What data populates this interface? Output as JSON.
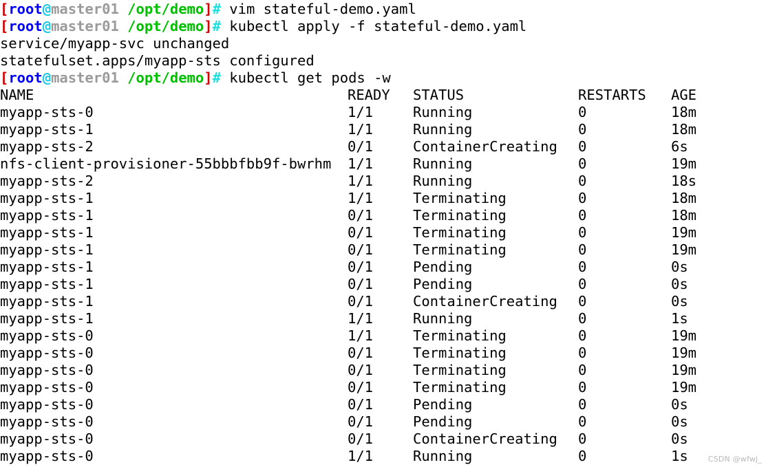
{
  "terminal": {
    "prompt": {
      "open_bracket": "[",
      "user": "root",
      "at": "@",
      "host": "master01",
      "path": "/opt/demo",
      "close_bracket": "]",
      "hash": "#"
    },
    "commands": {
      "cmd1": " vim stateful-demo.yaml",
      "cmd2": " kubectl apply -f stateful-demo.yaml",
      "cmd3": " kubectl get pods -w"
    },
    "apply_output": {
      "line1": "service/myapp-svc unchanged",
      "line2": "statefulset.apps/myapp-sts configured"
    },
    "table": {
      "headers": {
        "name": "NAME",
        "ready": "READY",
        "status": "STATUS",
        "restarts": "RESTARTS",
        "age": "AGE"
      },
      "rows": [
        {
          "name": "myapp-sts-0",
          "ready": "1/1",
          "status": "Running",
          "restarts": "0",
          "age": "18m"
        },
        {
          "name": "myapp-sts-1",
          "ready": "1/1",
          "status": "Running",
          "restarts": "0",
          "age": "18m"
        },
        {
          "name": "myapp-sts-2",
          "ready": "0/1",
          "status": "ContainerCreating",
          "restarts": "0",
          "age": "6s"
        },
        {
          "name": "nfs-client-provisioner-55bbbfbb9f-bwrhm",
          "ready": "1/1",
          "status": "Running",
          "restarts": "0",
          "age": "19m"
        },
        {
          "name": "myapp-sts-2",
          "ready": "1/1",
          "status": "Running",
          "restarts": "0",
          "age": "18s"
        },
        {
          "name": "myapp-sts-1",
          "ready": "1/1",
          "status": "Terminating",
          "restarts": "0",
          "age": "18m"
        },
        {
          "name": "myapp-sts-1",
          "ready": "0/1",
          "status": "Terminating",
          "restarts": "0",
          "age": "18m"
        },
        {
          "name": "myapp-sts-1",
          "ready": "0/1",
          "status": "Terminating",
          "restarts": "0",
          "age": "19m"
        },
        {
          "name": "myapp-sts-1",
          "ready": "0/1",
          "status": "Terminating",
          "restarts": "0",
          "age": "19m"
        },
        {
          "name": "myapp-sts-1",
          "ready": "0/1",
          "status": "Pending",
          "restarts": "0",
          "age": "0s"
        },
        {
          "name": "myapp-sts-1",
          "ready": "0/1",
          "status": "Pending",
          "restarts": "0",
          "age": "0s"
        },
        {
          "name": "myapp-sts-1",
          "ready": "0/1",
          "status": "ContainerCreating",
          "restarts": "0",
          "age": "0s"
        },
        {
          "name": "myapp-sts-1",
          "ready": "1/1",
          "status": "Running",
          "restarts": "0",
          "age": "1s"
        },
        {
          "name": "myapp-sts-0",
          "ready": "1/1",
          "status": "Terminating",
          "restarts": "0",
          "age": "19m"
        },
        {
          "name": "myapp-sts-0",
          "ready": "0/1",
          "status": "Terminating",
          "restarts": "0",
          "age": "19m"
        },
        {
          "name": "myapp-sts-0",
          "ready": "0/1",
          "status": "Terminating",
          "restarts": "0",
          "age": "19m"
        },
        {
          "name": "myapp-sts-0",
          "ready": "0/1",
          "status": "Terminating",
          "restarts": "0",
          "age": "19m"
        },
        {
          "name": "myapp-sts-0",
          "ready": "0/1",
          "status": "Pending",
          "restarts": "0",
          "age": "0s"
        },
        {
          "name": "myapp-sts-0",
          "ready": "0/1",
          "status": "Pending",
          "restarts": "0",
          "age": "0s"
        },
        {
          "name": "myapp-sts-0",
          "ready": "0/1",
          "status": "ContainerCreating",
          "restarts": "0",
          "age": "0s"
        },
        {
          "name": "myapp-sts-0",
          "ready": "1/1",
          "status": "Running",
          "restarts": "0",
          "age": "1s"
        }
      ]
    },
    "watermark": "CSDN @wfwj_"
  },
  "colors": {
    "background": "#ffffff",
    "text": "#000000",
    "bracket_red": "#d40000",
    "user_blue": "#0000ff",
    "at_cyan": "#18c8e6",
    "host_gray": "#9a9a9a",
    "path_green": "#00c000",
    "hash_cyan": "#1ee0e0",
    "watermark_gray": "#b9b9b9"
  }
}
